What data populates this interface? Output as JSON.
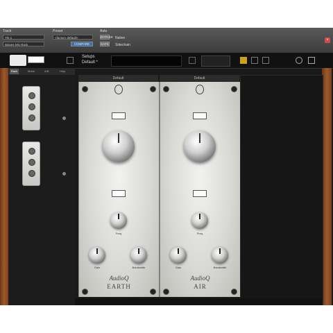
{
  "topbar": {
    "track_label": "Track",
    "track_value": "Trk 1",
    "track_sub": "Waves Mix Rack",
    "preset_label": "Preset",
    "preset_value": "<factory default>",
    "compare_label": "COMPARE",
    "auto_label": "Auto",
    "auto_bypass": "BYPASS",
    "auto_safe": "SAFE",
    "auto_native": "Native",
    "auto_sidechain": "Sidechain"
  },
  "header2": {
    "setup_label": "Setups",
    "setup_value": "Default *"
  },
  "rack": {
    "tabs": [
      "Rack",
      "Mods",
      "A/B",
      "Help"
    ]
  },
  "modules": [
    {
      "tab": "Default",
      "brand_script": "AudioQ",
      "name": "EARTH",
      "freq_label": "Freq",
      "gain_label": "Gain",
      "bw_label": "Bandwidth"
    },
    {
      "tab": "Default",
      "brand_script": "AudioQ",
      "name": "AIR",
      "freq_label": "Freq",
      "gain_label": "Gain",
      "bw_label": "Bandwidth"
    }
  ],
  "icons": {
    "close": "close-icon",
    "logo": "brand-logo-icon",
    "screw": "screw-icon"
  },
  "colors": {
    "panel": "#d8d8d4",
    "wood": "#9c5a2c",
    "accent": "#c9a21e"
  }
}
